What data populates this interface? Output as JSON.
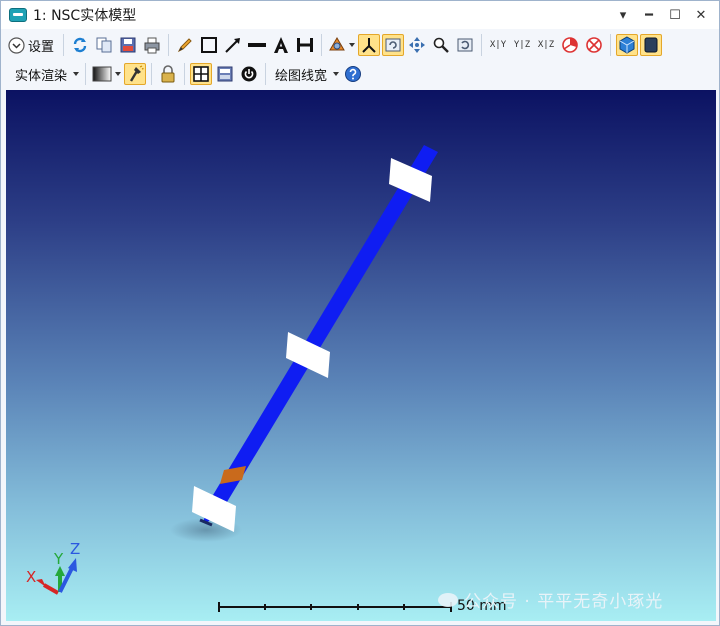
{
  "window": {
    "title": "1: NSC实体模型",
    "controls": [
      "▾",
      "━",
      "☐",
      "✕"
    ]
  },
  "toolbar1": {
    "settings_label": "设置",
    "axis_buttons": [
      "X|Y",
      "Y|Z",
      "X|Z"
    ]
  },
  "toolbar2": {
    "render_label": "实体渲染",
    "linewidth_label": "绘图线宽"
  },
  "viewport": {
    "scale_label": "50 mm",
    "axis_labels": {
      "x": "X",
      "y": "Y",
      "z": "Z"
    },
    "watermark": "公众号 · 平平无奇小琢光"
  },
  "colors": {
    "beam": "#0f1df2",
    "plate": "#ffffff",
    "source": "#c96a1c",
    "accent": "#ffe28a",
    "bg_top": "#0b1262",
    "bg_bottom": "#a8eef3"
  },
  "icons": {
    "settings": "chevron-down-circle-icon",
    "refresh": "refresh-icon",
    "copy": "copy-icon",
    "save": "save-icon",
    "print": "print-icon",
    "pencil": "pencil-icon",
    "rectangle": "rectangle-icon",
    "arrow": "arrow-line-icon",
    "line": "line-icon",
    "text": "text-icon",
    "dimension": "dimension-icon",
    "rotate-view": "rotate-view-icon",
    "axes": "axes-icon",
    "fit": "fit-view-icon",
    "pan": "pan-icon",
    "zoom": "zoom-icon",
    "reset": "reset-icon",
    "pie1": "clipping-icon",
    "pie2": "no-clipping-icon",
    "cube": "cube-icon",
    "window": "dark-window-icon",
    "gradient": "gradient-icon",
    "light": "light-icon",
    "lock": "lock-icon",
    "grid": "grid-icon",
    "save2": "export-image-icon",
    "power": "power-icon",
    "help": "help-icon"
  }
}
